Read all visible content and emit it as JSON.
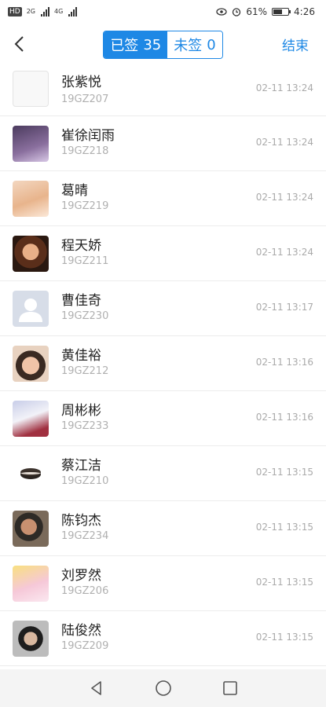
{
  "status_bar": {
    "hd_badge": "HD",
    "signal_1_label": "2G",
    "signal_2_label": "4G",
    "battery_percent": "61%",
    "battery_level": 0.61,
    "time": "4:26"
  },
  "header": {
    "signed_label": "已签",
    "signed_count": "35",
    "unsigned_label": "未签",
    "unsigned_count": "0",
    "end_label": "结束",
    "accent_color": "#1e88e5"
  },
  "records": [
    {
      "name": "张紫悦",
      "id": "19GZ207",
      "time": "02-11 13:24",
      "avatar": "sketch-avatar"
    },
    {
      "name": "崔徐闰雨",
      "id": "19GZ218",
      "time": "02-11 13:24",
      "avatar": "anime-avatar"
    },
    {
      "name": "葛晴",
      "id": "19GZ219",
      "time": "02-11 13:24",
      "avatar": "anime-avatar"
    },
    {
      "name": "程天娇",
      "id": "19GZ211",
      "time": "02-11 13:24",
      "avatar": "photo-avatar"
    },
    {
      "name": "曹佳奇",
      "id": "19GZ230",
      "time": "02-11 13:17",
      "avatar": "default-user-avatar"
    },
    {
      "name": "黄佳裕",
      "id": "19GZ212",
      "time": "02-11 13:16",
      "avatar": "photo-avatar"
    },
    {
      "name": "周彬彬",
      "id": "19GZ233",
      "time": "02-11 13:16",
      "avatar": "anime-avatar"
    },
    {
      "name": "蔡江洁",
      "id": "19GZ210",
      "time": "02-11 13:15",
      "avatar": "cookie-avatar"
    },
    {
      "name": "陈钧杰",
      "id": "19GZ234",
      "time": "02-11 13:15",
      "avatar": "photo-avatar"
    },
    {
      "name": "刘罗然",
      "id": "19GZ206",
      "time": "02-11 13:15",
      "avatar": "anime-avatar"
    },
    {
      "name": "陆俊然",
      "id": "19GZ209",
      "time": "02-11 13:15",
      "avatar": "photo-avatar"
    }
  ],
  "nav": {
    "back_icon": "triangle-back-icon",
    "home_icon": "circle-home-icon",
    "recent_icon": "square-recents-icon"
  }
}
